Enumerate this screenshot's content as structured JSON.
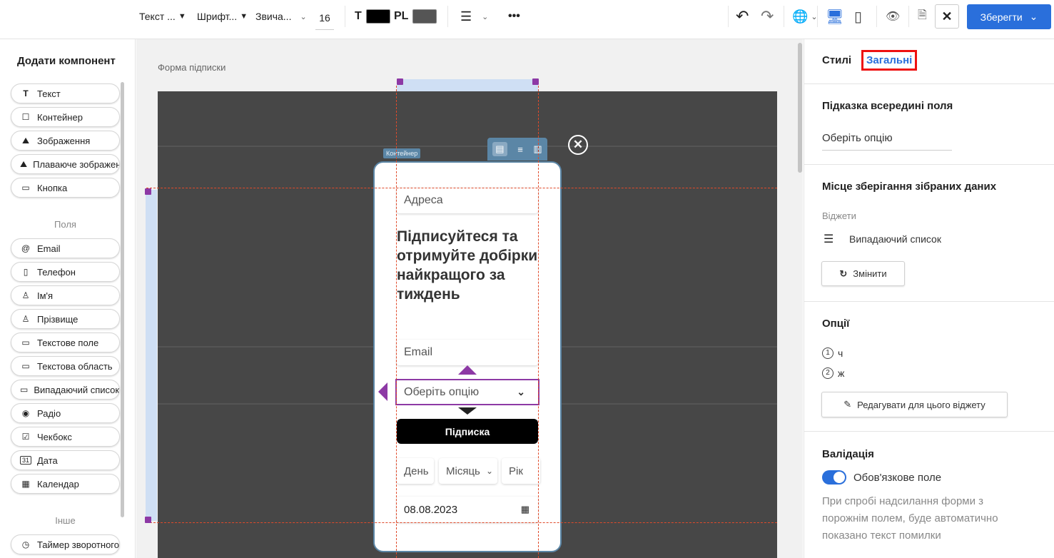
{
  "toolbar": {
    "text_style": "Текст ...",
    "font": "Шрифт...",
    "weight": "Звича...",
    "font_size": "16",
    "text_color_label": "T",
    "lang_label": "PL",
    "colors": {
      "text": "#000000",
      "lang": "#555555",
      "accent": "#2a6fdb"
    },
    "save_label": "Зберегти",
    "more": "•••"
  },
  "sidebar": {
    "title": "Додати компонент",
    "basic": [
      {
        "label": "Текст",
        "icon": "T"
      },
      {
        "label": "Контейнер",
        "icon": "☐"
      },
      {
        "label": "Зображення",
        "icon": "⛰"
      },
      {
        "label": "Плаваюче зображення",
        "icon": "⛰"
      },
      {
        "label": "Кнопка",
        "icon": "▭"
      }
    ],
    "fields_label": "Поля",
    "fields": [
      {
        "label": "Email",
        "icon": "@"
      },
      {
        "label": "Телефон",
        "icon": "▯"
      },
      {
        "label": "Ім'я",
        "icon": "♙"
      },
      {
        "label": "Прізвище",
        "icon": "♙"
      },
      {
        "label": "Текстове поле",
        "icon": "▭"
      },
      {
        "label": "Текстова область",
        "icon": "▭"
      },
      {
        "label": "Випадаючий список",
        "icon": "▭"
      },
      {
        "label": "Радіо",
        "icon": "◉"
      },
      {
        "label": "Чекбокс",
        "icon": "☑"
      },
      {
        "label": "Дата",
        "icon": "31"
      },
      {
        "label": "Календар",
        "icon": "▦"
      }
    ],
    "other_label": "Інше",
    "other": [
      {
        "label": "Таймер зворотного",
        "icon": "◷"
      }
    ]
  },
  "canvas": {
    "form_label": "Форма підписки",
    "container_tag": "Контейнер",
    "address_placeholder": "Адреса",
    "heading": "Підписуйтеся та отримуйте добірки найкращого за тиждень",
    "email_placeholder": "Email",
    "select_placeholder": "Оберіть опцію",
    "subscribe_label": "Підписка",
    "day_placeholder": "День",
    "month_placeholder": "Місяць",
    "year_placeholder": "Рік",
    "date_value": "08.08.2023"
  },
  "panel": {
    "tab_styles": "Стилі",
    "tab_general": "Загальні",
    "hint_title": "Підказка всередині поля",
    "hint_value": "Оберіть опцію",
    "storage_title": "Місце зберігання зібраних даних",
    "widgets_label": "Віджети",
    "widget_name": "Випадаючий список",
    "change_label": "Змінити",
    "options_title": "Опції",
    "options": [
      {
        "num": "1",
        "label": "ч"
      },
      {
        "num": "2",
        "label": "ж"
      }
    ],
    "edit_label": "Редагувати для цього віджету",
    "validation_title": "Валідація",
    "required_label": "Обов'язкове поле",
    "required_on": true,
    "validation_hint": "При спробі надсилання форми з порожнім полем, буде автоматично показано текст помилки"
  }
}
